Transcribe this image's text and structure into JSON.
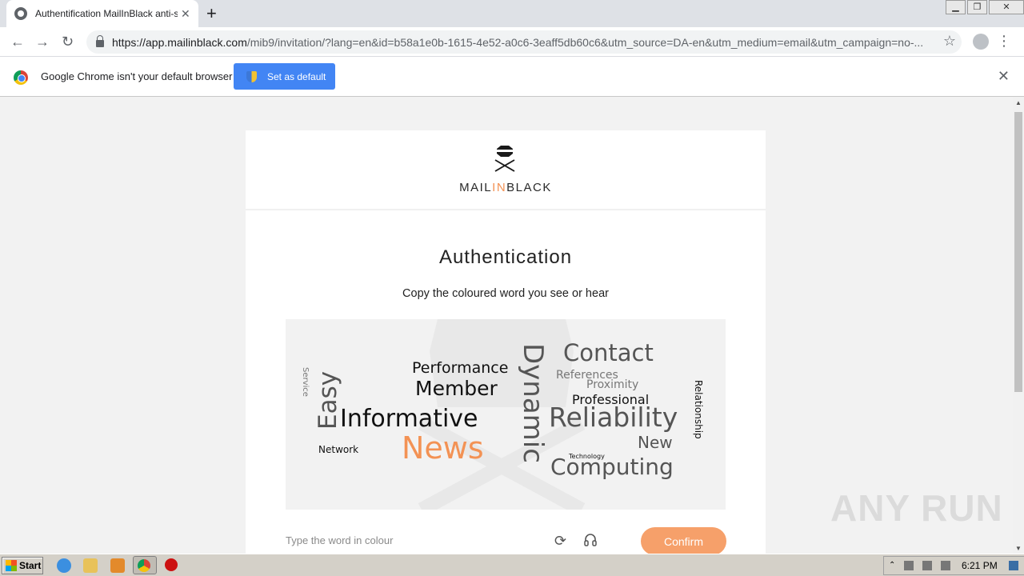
{
  "browser": {
    "tab_title": "Authentification MailInBlack anti-spam",
    "url_host": "https://app.mailinblack.com",
    "url_path": "/mib9/invitation/?lang=en&id=b58a1e0b-1615-4e52-a0c6-3eaff5db60c6&utm_source=DA-en&utm_medium=email&utm_campaign=no-...",
    "infobar_text": "Google Chrome isn't your default browser",
    "set_default_label": "Set as default"
  },
  "page": {
    "brand_prefix": "MAIL",
    "brand_accent": "IN",
    "brand_suffix": "BLACK",
    "heading": "Authentication",
    "subheading": "Copy the coloured word you see or hear",
    "input_placeholder": "Type the word in colour",
    "confirm_label": "Confirm",
    "accent_color": "#f39254"
  },
  "captcha": {
    "words": [
      "Contact",
      "Performance",
      "Member",
      "References",
      "Proximity",
      "Professional",
      "Informative",
      "Reliability",
      "Service",
      "Easy",
      "Dynamic",
      "Relationship",
      "News",
      "New",
      "Network",
      "Technology",
      "Computing"
    ],
    "colored_word": "News"
  },
  "watermark": "ANY RUN",
  "taskbar": {
    "start_label": "Start",
    "clock": "6:21 PM"
  }
}
